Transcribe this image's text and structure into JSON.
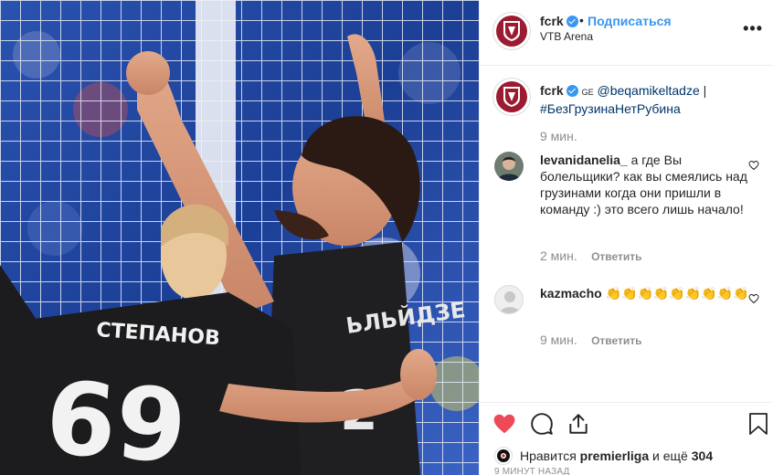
{
  "post": {
    "username": "fcrk",
    "follow_label": "Подписаться",
    "separator": "•",
    "location": "VTB Arena",
    "more_icon": "more-horizontal-icon",
    "more_label": "•••"
  },
  "caption": {
    "username": "fcrk",
    "flag": "GE",
    "mention": "@beqamikeltadze",
    "divider": "|",
    "hashtag": "#БезГрузинаНетРубина",
    "time": "9 мин."
  },
  "comments": [
    {
      "username": "levanidanelia_",
      "text": "а где Вы болельщики? как вы смеялись над грузинами когда они пришли в команду :) это всего лишь начало!",
      "time": "2 мин.",
      "reply_label": "Ответить"
    },
    {
      "username": "kazmacho",
      "text": "👏👏👏👏👏👏👏👏👏",
      "time": "9 мин.",
      "reply_label": "Ответить"
    }
  ],
  "actions": {
    "like_icon": "heart-filled-icon",
    "comment_icon": "comment-icon",
    "share_icon": "share-icon",
    "save_icon": "bookmark-icon"
  },
  "likes": {
    "prefix": "Нравится",
    "user": "premierliga",
    "middle": "и ещё",
    "count": "304"
  },
  "timestamp": "9 МИНУТ НАЗАД",
  "photo": {
    "jersey_name_front": "СТЕПАНОВ",
    "jersey_number_front": "69"
  },
  "colors": {
    "brand_red": "#9b1b30",
    "link_blue": "#3897f0",
    "like_red": "#ed4956",
    "muted": "#8e8e8e"
  }
}
